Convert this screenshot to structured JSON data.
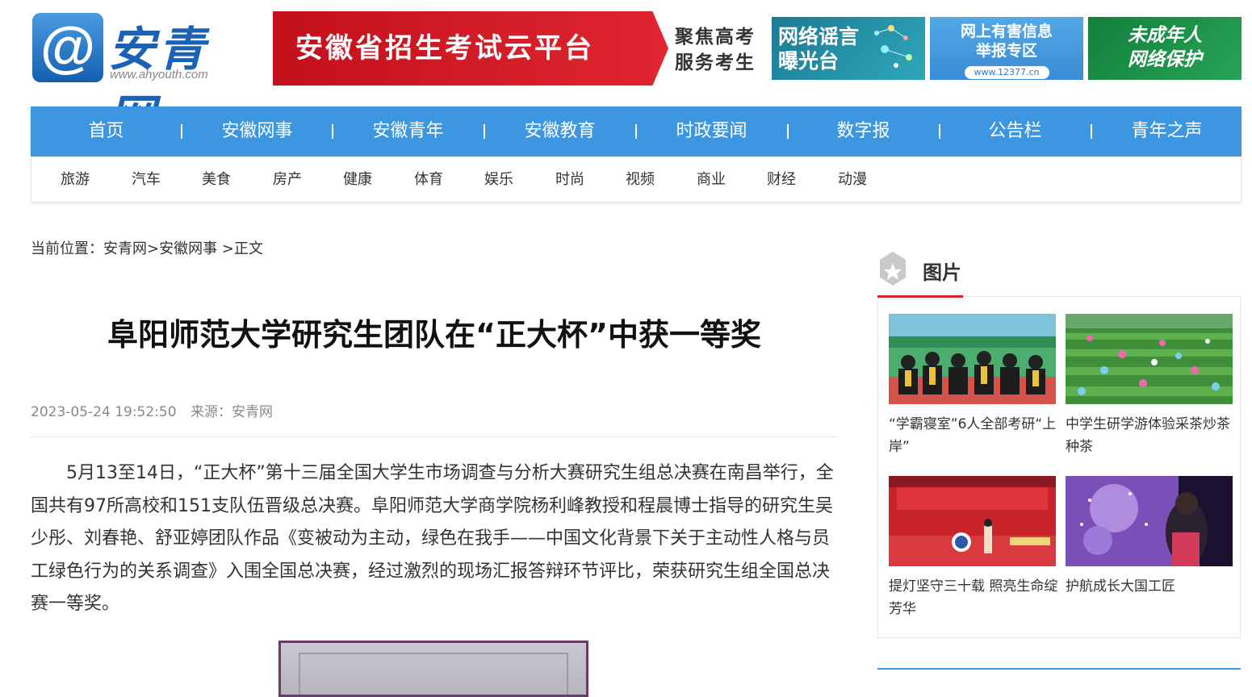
{
  "header": {
    "logo_symbol": "@",
    "logo_cn": "安青网",
    "logo_url": "www.ahyouth.com",
    "banner_main": "安徽省招生考试云平台",
    "banner_side_1": "聚焦高考",
    "banner_side_2": "服务考生",
    "ad1_line1": "网络谣言",
    "ad1_line2": "曝光台",
    "ad2_line1": "网上有害信息",
    "ad2_line2": "举报专区",
    "ad2_url": "www.12377.cn",
    "ad3_line1": "未成年人",
    "ad3_line2": "网络保护"
  },
  "nav": {
    "main": [
      "首页",
      "安徽网事",
      "安徽青年",
      "安徽教育",
      "时政要闻",
      "数字报",
      "公告栏",
      "青年之声"
    ],
    "sub": [
      "旅游",
      "汽车",
      "美食",
      "房产",
      "健康",
      "体育",
      "娱乐",
      "时尚",
      "视频",
      "商业",
      "财经",
      "动漫"
    ]
  },
  "breadcrumb": "当前位置：安青网>安徽网事 >正文",
  "article": {
    "title": "阜阳师范大学研究生团队在“正大杯”中获一等奖",
    "date": "2023-05-24 19:52:50",
    "source": "来源：安青网",
    "body": "5月13至14日，“正大杯”第十三届全国大学生市场调查与分析大赛研究生组总决赛在南昌举行，全国共有97所高校和151支队伍晋级总决赛。阜阳师范大学商学院杨利峰教授和程晨博士指导的研究生吴少彤、刘春艳、舒亚婷团队作品《变被动为主动，绿色在我手——中国文化背景下关于主动性人格与员工绿色行为的关系调查》入围全国总决赛，经过激烈的现场汇报答辩环节评比，荣获研究生组全国总决赛一等奖。"
  },
  "sidebar": {
    "title": "图片",
    "items": [
      {
        "caption": "“学霸寝室”6人全部考研“上岸”"
      },
      {
        "caption": "中学生研学游体验采茶炒茶种茶"
      },
      {
        "caption": "提灯坚守三十载 照亮生命绽芳华"
      },
      {
        "caption": "护航成长大国工匠"
      }
    ]
  },
  "colors": {
    "nav_blue": "#3d97e0",
    "brand_red": "#d6222c",
    "logo_blue": "#1a62b6"
  }
}
